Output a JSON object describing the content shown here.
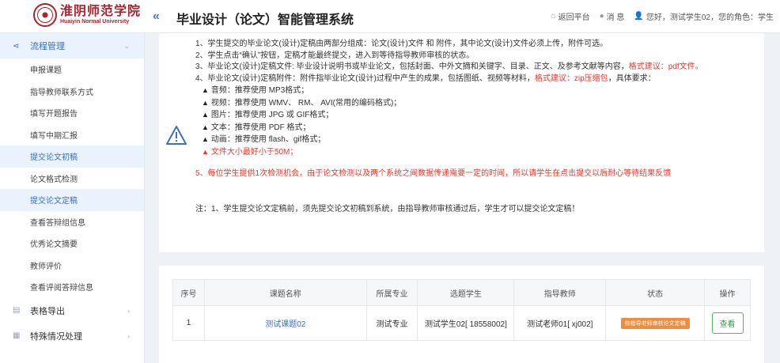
{
  "header": {
    "logo_cn": "淮阴师范学院",
    "logo_en": "Huaiyin Normal University",
    "system_title": "毕业设计（论文）智能管理系统",
    "back_label": "返回平台",
    "message_label": "消 息",
    "user_greeting": "您好，测试学生02，您的角色：学生"
  },
  "sidebar": {
    "group_process": "流程管理",
    "items": [
      "申报课题",
      "指导教师联系方式",
      "填写开题报告",
      "填写中期汇报",
      "提交论文初稿",
      "论文格式检测",
      "提交论文定稿",
      "查看答辩组信息",
      "优秀论文摘要",
      "教师评价",
      "查看评阅答辩信息"
    ],
    "group_export": "表格导出",
    "group_special": "特殊情况处理"
  },
  "notes": {
    "l1": "1、学生提交的毕业论文(设计)定稿由两部分组成：论文(设计)文件 和 附件，其中论文(设计)文件必须上传，附件可选。",
    "l2": "2、学生点击“确认”按钮，定稿才能最终提交，进入到等待指导教师审核的状态。",
    "l3": "3、毕业论文(设计)定稿文件: 毕业设计说明书或毕业论文，包括封面、中外文摘和关键字、目录、正文、及参考文献等内容，",
    "l3_red": "格式建议：pdf文件。",
    "l4": "4、毕业论文(设计)定稿附件：附件指毕业论文(设计)过程中产生的成果，包括图纸、视频等材料，",
    "l4_red": "格式建议：zip压缩包",
    "l4_tail": "，具体要求：",
    "b1": "音频：推荐使用 MP3格式；",
    "b2": "视频：推荐使用 WMV、 RM、 AVI(常用的编码格式)；",
    "b3": "图片：推荐使用 JPG 或 GIF格式；",
    "b4": "文本：推荐使用 PDF 格式；",
    "b5": "动画：推荐使用 flash、gif格式；",
    "b6": "文件大小最好小于50M；",
    "l5": "5、每位学生提供1次检测机会，由于论文检测以及两个系统之间数据传递需要一定的时间，所以请学生在点击提交以后耐心等待结果反馈",
    "note": "注：1、学生提交论文定稿前，须先提交论文初稿到系统，由指导教师审核通过后，学生才可以提交论文定稿！"
  },
  "table": {
    "headers": [
      "序号",
      "课题名称",
      "所属专业",
      "选题学生",
      "指导教师",
      "状态",
      "操作"
    ],
    "row": {
      "index": "1",
      "topic": "测试课题02",
      "major": "测试专业",
      "student": "测试学生02[ 18558002]",
      "teacher": "测试老师01[ xj002]",
      "status": "待指导老师审核论文定稿",
      "action": "查看"
    }
  },
  "colors": {
    "accent": "#3d6fc4",
    "brand": "#a8232e",
    "warning": "#e8382c",
    "status": "#f08c3d",
    "action": "#52b86c"
  }
}
